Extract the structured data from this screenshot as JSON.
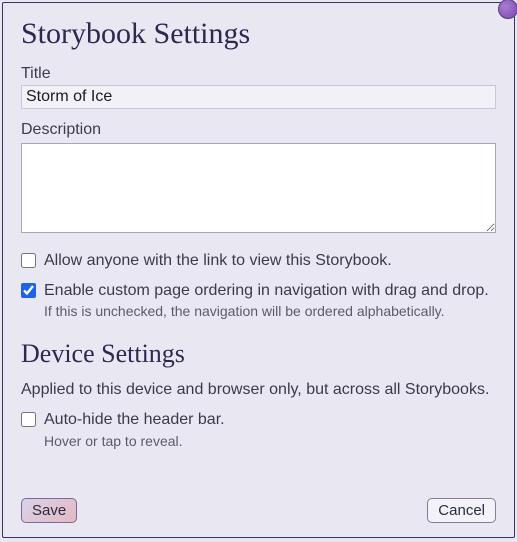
{
  "storybook": {
    "heading": "Storybook Settings",
    "title_label": "Title",
    "title_value": "Storm of Ice",
    "description_label": "Description",
    "description_value": "",
    "allow_link": {
      "label": "Allow anyone with the link to view this Storybook.",
      "checked": false
    },
    "custom_order": {
      "label": "Enable custom page ordering in navigation with drag and drop.",
      "checked": true,
      "hint": "If this is unchecked, the navigation will be ordered alphabetically."
    }
  },
  "device": {
    "heading": "Device Settings",
    "subtext": "Applied to this device and browser only, but across all Storybooks.",
    "autohide": {
      "label": "Auto-hide the header bar.",
      "checked": false,
      "hint": "Hover or tap to reveal."
    }
  },
  "buttons": {
    "save": "Save",
    "cancel": "Cancel"
  }
}
